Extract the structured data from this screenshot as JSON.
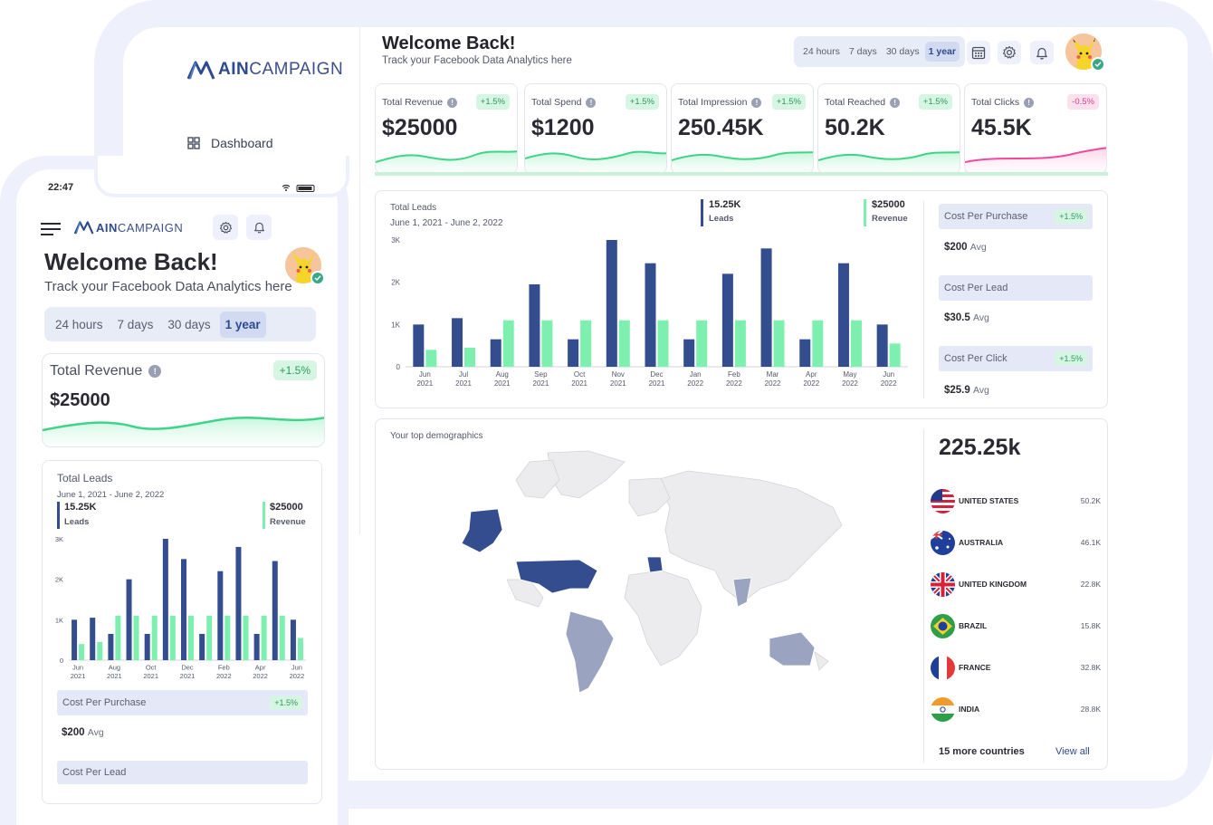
{
  "brand": {
    "part1": "AIN",
    "part2": "CAMPAIGN"
  },
  "sidebar": {
    "items": [
      {
        "label": "Dashboard"
      }
    ]
  },
  "header": {
    "title": "Welcome Back!",
    "subtitle": "Track your Facebook Data Analytics here",
    "ranges": [
      "24 hours",
      "7 days",
      "30 days",
      "1 year"
    ],
    "active_range": "1 year"
  },
  "kpis": [
    {
      "label": "Total Revenue",
      "value": "$25000",
      "change": "+1.5%",
      "trend": "up"
    },
    {
      "label": "Total Spend",
      "value": "$1200",
      "change": "+1.5%",
      "trend": "up"
    },
    {
      "label": "Total Impression",
      "value": "250.45K",
      "change": "+1.5%",
      "trend": "up"
    },
    {
      "label": "Total Reached",
      "value": "50.2K",
      "change": "+1.5%",
      "trend": "up"
    },
    {
      "label": "Total Clicks",
      "value": "45.5K",
      "change": "-0.5%",
      "trend": "down"
    }
  ],
  "leads": {
    "title": "Total Leads",
    "date_range": "June 1, 2021 - June 2, 2022",
    "leads_value": "15.25K",
    "leads_label": "Leads",
    "revenue_value": "$25000",
    "revenue_label": "Revenue"
  },
  "metrics": [
    {
      "label": "Cost Per Purchase",
      "badge": "+1.5%",
      "value": "$200",
      "suffix": "Avg"
    },
    {
      "label": "Cost Per Lead",
      "badge": "",
      "value": "$30.5",
      "suffix": "Avg"
    },
    {
      "label": "Cost Per Click",
      "badge": "+1.5%",
      "value": "$25.9",
      "suffix": "Avg"
    }
  ],
  "demographics": {
    "title": "Your top demographics",
    "total": "225.25k",
    "countries": [
      {
        "name": "UNITED STATES",
        "value": "50.2K",
        "flag": "us-flag"
      },
      {
        "name": "AUSTRALIA",
        "value": "46.1K",
        "flag": "au-flag"
      },
      {
        "name": "UNITED KINGDOM",
        "value": "22.8K",
        "flag": "uk-flag"
      },
      {
        "name": "BRAZIL",
        "value": "15.8K",
        "flag": "br-flag"
      },
      {
        "name": "FRANCE",
        "value": "32.8K",
        "flag": "fr-flag"
      },
      {
        "name": "INDIA",
        "value": "28.8K",
        "flag": "in-flag"
      }
    ],
    "more": "15 more countries",
    "view_all": "View all"
  },
  "phone": {
    "time": "22:47",
    "title": "Welcome Back!",
    "subtitle": "Track your Facebook Data Analytics here",
    "ranges": [
      "24 hours",
      "7 days",
      "30 days",
      "1 year"
    ],
    "revenue_label": "Total Revenue",
    "revenue_value": "$25000",
    "revenue_change": "+1.5%",
    "leads_title": "Total Leads",
    "leads_date": "June 1, 2021 - June 2, 2022",
    "leads_value": "15.25K",
    "leads_label": "Leads",
    "rev_value": "$25000",
    "rev_label": "Revenue",
    "metric1_label": "Cost Per Purchase",
    "metric1_badge": "+1.5%",
    "metric1_value": "$200",
    "metric1_suffix": "Avg",
    "metric2_label": "Cost Per Lead"
  },
  "colors": {
    "leads": "#344d8f",
    "revenue": "#7df0b0",
    "accent": "#2e4a8e",
    "up": "#2f9a61",
    "down": "#d6418c"
  },
  "chart_data": [
    {
      "type": "bar",
      "categories": [
        "Jun 2021",
        "Jul 2021",
        "Aug 2021",
        "Sep 2021",
        "Oct 2021",
        "Nov 2021",
        "Dec 2021",
        "Jan 2022",
        "Feb 2022",
        "Mar 2022",
        "Apr 2022",
        "May 2022",
        "Jun 2022"
      ],
      "series": [
        {
          "name": "Leads",
          "values": [
            1000,
            1150,
            650,
            1950,
            650,
            3000,
            2450,
            650,
            2200,
            2800,
            650,
            2450,
            1000
          ]
        },
        {
          "name": "Revenue",
          "values": [
            400,
            450,
            1100,
            1100,
            1100,
            1100,
            1100,
            1100,
            1100,
            1100,
            1100,
            1100,
            550
          ]
        }
      ],
      "yticks": [
        "0",
        "1K",
        "2K",
        "3K"
      ],
      "ylim": [
        0,
        3000
      ]
    },
    {
      "type": "bar",
      "categories": [
        "Jun 2021",
        "Jul 2021",
        "Aug 2021",
        "Sep 2021",
        "Oct 2021",
        "Nov 2021",
        "Dec 2021",
        "Jan 2022",
        "Feb 2022",
        "Mar 2022",
        "Apr 2022",
        "May 2022",
        "Jun 2022"
      ],
      "series": [
        {
          "name": "Leads",
          "values": [
            1000,
            1050,
            650,
            2000,
            650,
            3000,
            2500,
            650,
            2200,
            2800,
            650,
            2450,
            1000
          ]
        },
        {
          "name": "Revenue",
          "values": [
            400,
            450,
            1100,
            1100,
            1100,
            1100,
            1100,
            1100,
            1100,
            1100,
            1100,
            1100,
            550
          ]
        }
      ],
      "yticks": [
        "0",
        "1K",
        "2K",
        "3K"
      ],
      "ylim": [
        0,
        3000
      ]
    }
  ]
}
